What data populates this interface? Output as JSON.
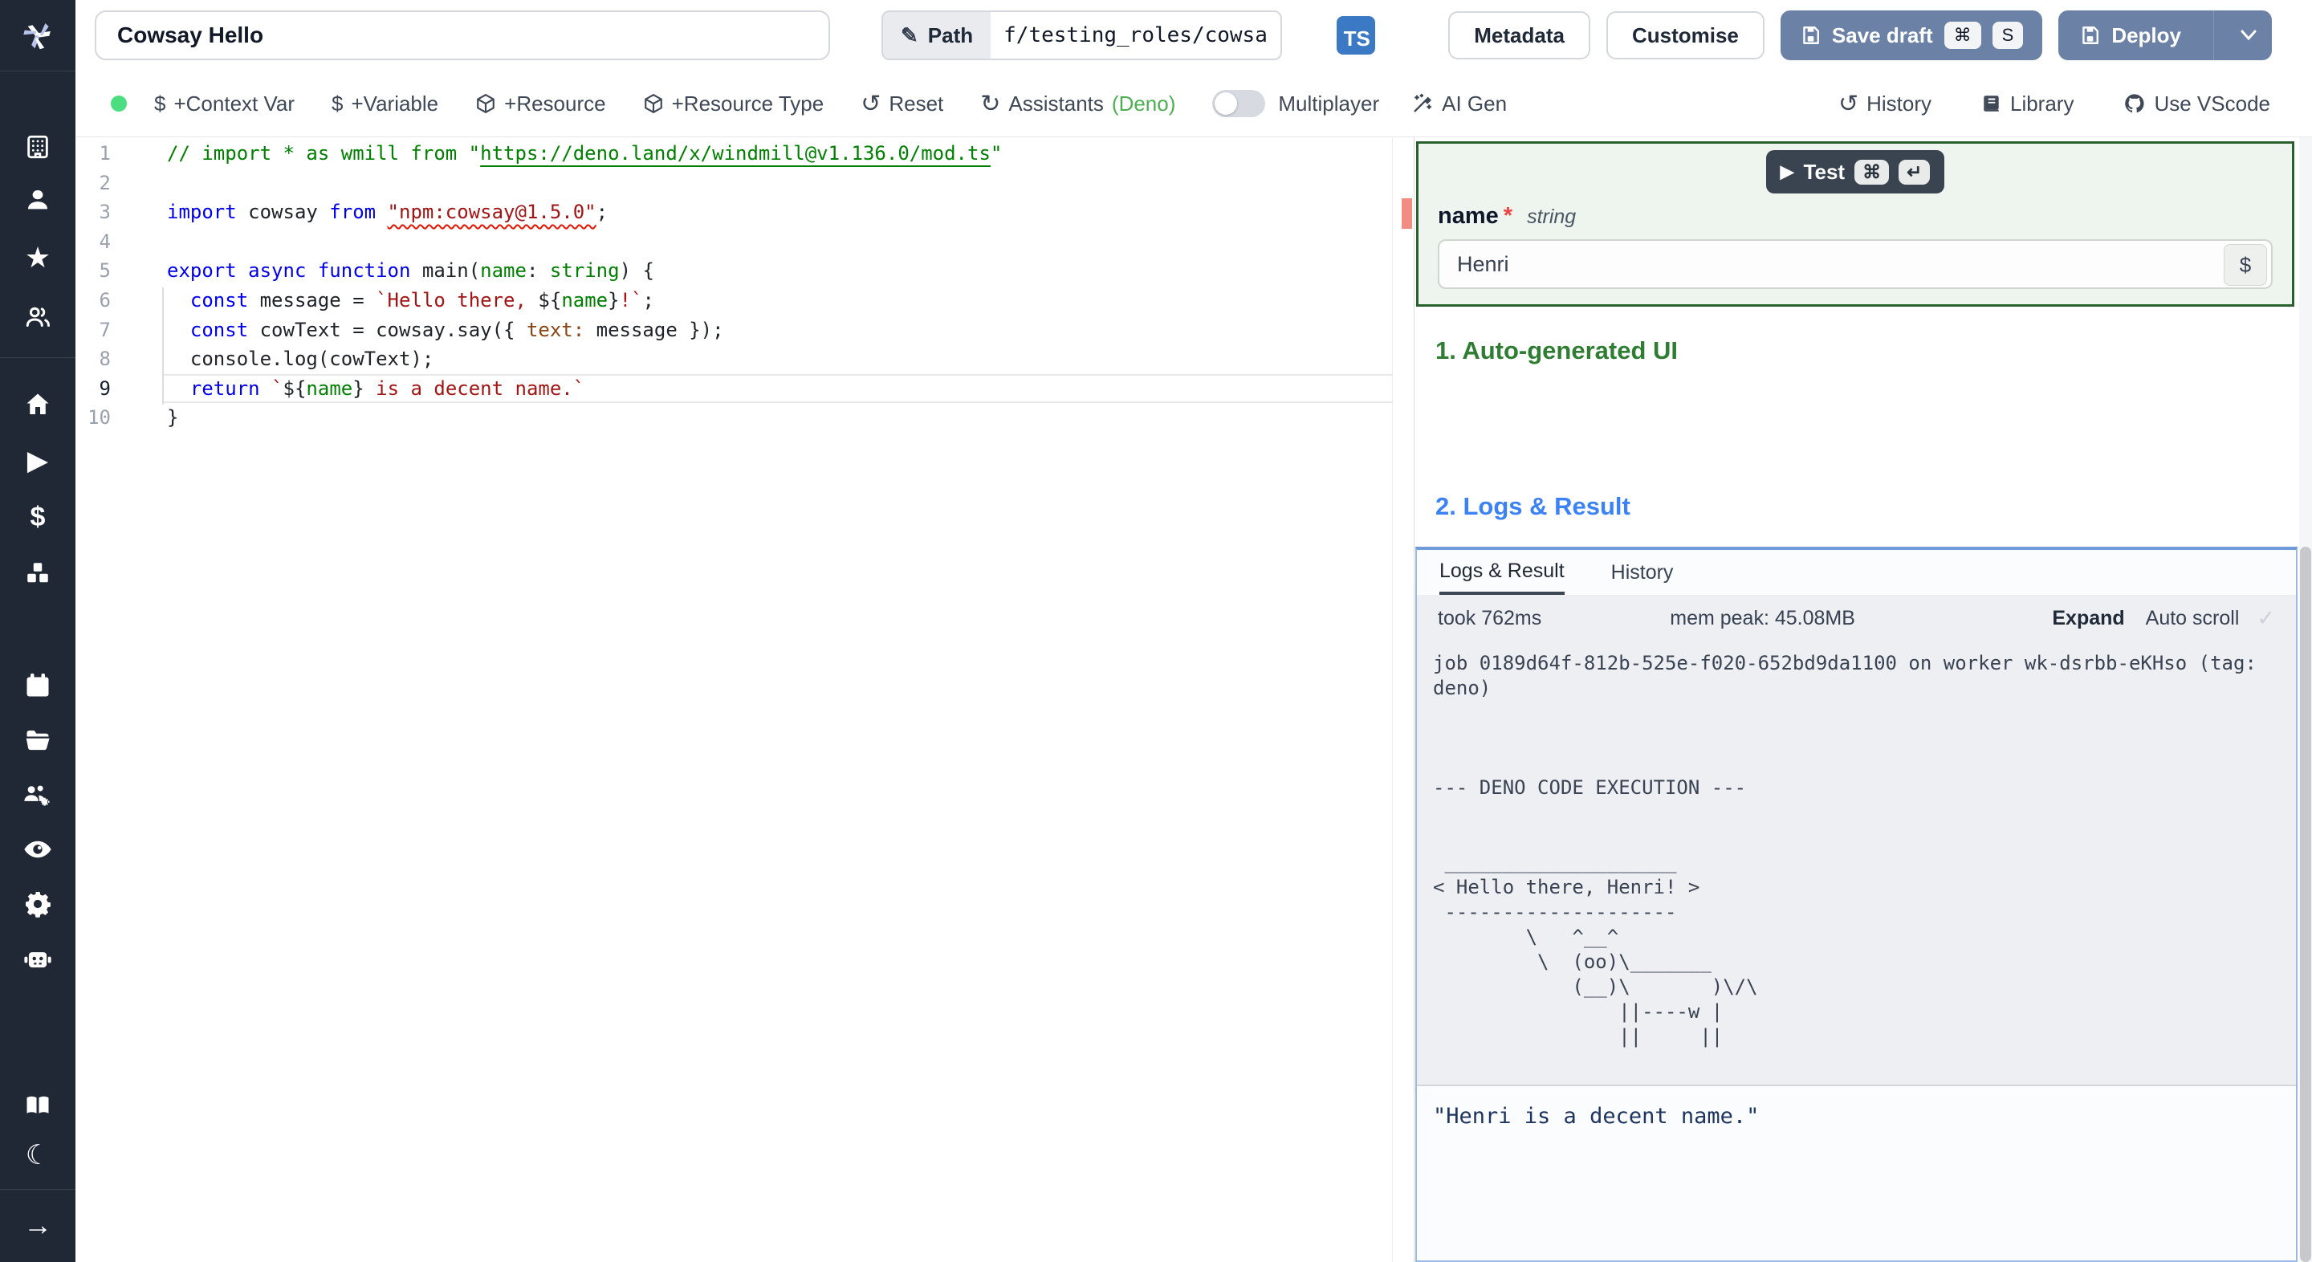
{
  "topbar": {
    "title_value": "Cowsay Hello",
    "path_label": "Path",
    "path_value": "f/testing_roles/cowsa",
    "lang_badge": "TS",
    "metadata_label": "Metadata",
    "customise_label": "Customise",
    "save_draft_label": "Save draft",
    "save_kbd": [
      "⌘",
      "S"
    ],
    "deploy_label": "Deploy"
  },
  "toolbar": {
    "items": [
      {
        "icon": "dollar-icon",
        "label": "+Context Var"
      },
      {
        "icon": "dollar-icon",
        "label": "+Variable"
      },
      {
        "icon": "package-icon",
        "label": "+Resource"
      },
      {
        "icon": "package-icon",
        "label": "+Resource Type"
      },
      {
        "icon": "reset-icon",
        "label": "Reset"
      },
      {
        "icon": "refresh-icon",
        "label": "Assistants",
        "suffix": "(Deno)"
      }
    ],
    "multiplayer_label": "Multiplayer",
    "ai_gen_label": "AI Gen",
    "right_items": [
      {
        "icon": "history-icon",
        "label": "History"
      },
      {
        "icon": "library-icon",
        "label": "Library"
      },
      {
        "icon": "github-icon",
        "label": "Use VScode"
      }
    ]
  },
  "sidebar": {
    "icons": [
      "windmill-logo",
      "building",
      "person",
      "star",
      "users",
      "home",
      "play",
      "dollar",
      "cubes",
      "calendar",
      "folder",
      "users-gear",
      "eye",
      "gear",
      "robot",
      "book",
      "moon",
      "arrow-right"
    ]
  },
  "editor": {
    "lines": [
      {
        "num": "1",
        "tk": [
          {
            "t": "// import * as wmill from \"",
            "c": "c"
          },
          {
            "t": "https://deno.land/x/windmill@v1.136.0/mod.ts",
            "c": "cl"
          },
          {
            "t": "\"",
            "c": "c"
          }
        ]
      },
      {
        "num": "2",
        "tk": []
      },
      {
        "num": "3",
        "tk": [
          {
            "t": "import",
            "c": "k"
          },
          {
            "t": " cowsay ",
            "c": "p"
          },
          {
            "t": "from",
            "c": "k"
          },
          {
            "t": " ",
            "c": "p"
          },
          {
            "t": "\"npm:cowsay@1.5.0\"",
            "c": "ssq"
          },
          {
            "t": ";",
            "c": "p"
          }
        ]
      },
      {
        "num": "4",
        "tk": []
      },
      {
        "num": "5",
        "tk": [
          {
            "t": "export",
            "c": "k"
          },
          {
            "t": " ",
            "c": "p"
          },
          {
            "t": "async",
            "c": "k"
          },
          {
            "t": " ",
            "c": "p"
          },
          {
            "t": "function",
            "c": "k"
          },
          {
            "t": " main(",
            "c": "p"
          },
          {
            "t": "name",
            "c": "g"
          },
          {
            "t": ": ",
            "c": "p"
          },
          {
            "t": "string",
            "c": "g"
          },
          {
            "t": ") {",
            "c": "p"
          }
        ]
      },
      {
        "num": "6",
        "tk": [
          {
            "t": "  ",
            "c": "p"
          },
          {
            "t": "const",
            "c": "k"
          },
          {
            "t": " message = ",
            "c": "p"
          },
          {
            "t": "`Hello there, ",
            "c": "s"
          },
          {
            "t": "${",
            "c": "p"
          },
          {
            "t": "name",
            "c": "g"
          },
          {
            "t": "}",
            "c": "p"
          },
          {
            "t": "!`",
            "c": "s"
          },
          {
            "t": ";",
            "c": "p"
          }
        ]
      },
      {
        "num": "7",
        "tk": [
          {
            "t": "  ",
            "c": "p"
          },
          {
            "t": "const",
            "c": "k"
          },
          {
            "t": " cowText = cowsay.say({ ",
            "c": "p"
          },
          {
            "t": "text:",
            "c": "pr"
          },
          {
            "t": " message });",
            "c": "p"
          }
        ]
      },
      {
        "num": "8",
        "tk": [
          {
            "t": "  console.log(cowText);",
            "c": "p"
          }
        ]
      },
      {
        "num": "9",
        "cur": true,
        "tk": [
          {
            "t": "  ",
            "c": "p"
          },
          {
            "t": "return",
            "c": "k"
          },
          {
            "t": " ",
            "c": "p"
          },
          {
            "t": "`",
            "c": "s"
          },
          {
            "t": "${",
            "c": "p"
          },
          {
            "t": "name",
            "c": "g"
          },
          {
            "t": "}",
            "c": "p"
          },
          {
            "t": " is a decent name.`",
            "c": "s"
          }
        ]
      },
      {
        "num": "10",
        "tk": [
          {
            "t": "}",
            "c": "p"
          }
        ]
      }
    ]
  },
  "panel": {
    "test_label": "Test",
    "test_kbd": [
      "⌘",
      "↵"
    ],
    "field_name": "name",
    "field_required": "*",
    "field_type": "string",
    "field_value": "Henri",
    "dollar_button": "$",
    "section1": "1. Auto-generated UI",
    "section2": "2. Logs & Result",
    "tabs": [
      "Logs & Result",
      "History"
    ],
    "stats": {
      "took": "took 762ms",
      "mem": "mem peak: 45.08MB",
      "expand": "Expand",
      "autoscroll": "Auto scroll",
      "check": "✓"
    },
    "log_text": "job 0189d64f-812b-525e-f020-652bd9da1100 on worker wk-dsrbb-eKHso (tag:\ndeno)\n\n\n\n--- DENO CODE EXECUTION ---\n\n\n ____________________\n< Hello there, Henri! >\n --------------------\n        \\   ^__^\n         \\  (oo)\\_______\n            (__)\\       )\\/\\\n                ||----w |\n                ||     ||",
    "result_text": "\"Henri is a decent name.\""
  }
}
